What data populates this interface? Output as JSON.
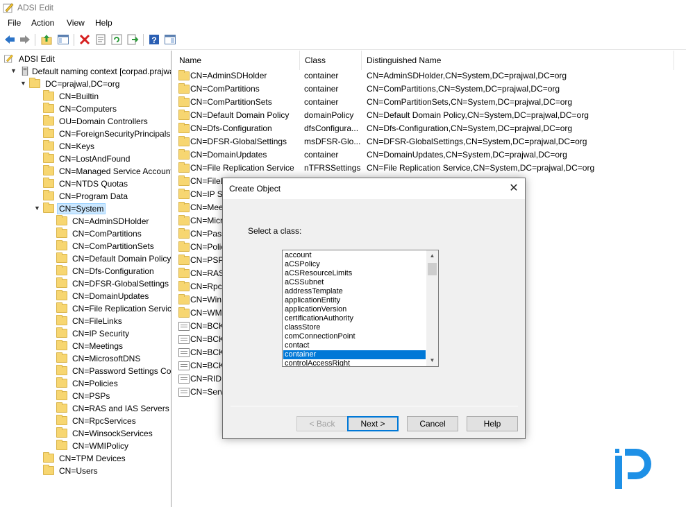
{
  "window": {
    "title": "ADSI Edit"
  },
  "menu": [
    "File",
    "Action",
    "View",
    "Help"
  ],
  "toolbar_icons": [
    "back-arrow-icon",
    "forward-arrow-icon",
    "up-folder-icon",
    "show-hide-tree-icon",
    "delete-icon",
    "properties-icon",
    "refresh-icon",
    "export-list-icon",
    "help-icon",
    "console-tree-icon"
  ],
  "tree": {
    "root": "ADSI Edit",
    "context": "Default naming context [corpad.prajwal.org]",
    "domain": "DC=prajwal,DC=org",
    "level1": [
      "CN=Builtin",
      "CN=Computers",
      "OU=Domain Controllers",
      "CN=ForeignSecurityPrincipals",
      "CN=Keys",
      "CN=LostAndFound",
      "CN=Managed Service Accounts",
      "CN=NTDS Quotas",
      "CN=Program Data",
      "CN=System"
    ],
    "system_children": [
      "CN=AdminSDHolder",
      "CN=ComPartitions",
      "CN=ComPartitionSets",
      "CN=Default Domain Policy",
      "CN=Dfs-Configuration",
      "CN=DFSR-GlobalSettings",
      "CN=DomainUpdates",
      "CN=File Replication Service",
      "CN=FileLinks",
      "CN=IP Security",
      "CN=Meetings",
      "CN=MicrosoftDNS",
      "CN=Password Settings Container",
      "CN=Policies",
      "CN=PSPs",
      "CN=RAS and IAS Servers Access Check",
      "CN=RpcServices",
      "CN=WinsockServices",
      "CN=WMIPolicy"
    ],
    "level1_after": [
      "CN=TPM Devices",
      "CN=Users"
    ]
  },
  "list": {
    "headers": [
      "Name",
      "Class",
      "Distinguished Name"
    ],
    "rows": [
      {
        "name": "CN=AdminSDHolder",
        "cls": "container",
        "dn": "CN=AdminSDHolder,CN=System,DC=prajwal,DC=org",
        "icon": "folder"
      },
      {
        "name": "CN=ComPartitions",
        "cls": "container",
        "dn": "CN=ComPartitions,CN=System,DC=prajwal,DC=org",
        "icon": "folder"
      },
      {
        "name": "CN=ComPartitionSets",
        "cls": "container",
        "dn": "CN=ComPartitionSets,CN=System,DC=prajwal,DC=org",
        "icon": "folder"
      },
      {
        "name": "CN=Default Domain Policy",
        "cls": "domainPolicy",
        "dn": "CN=Default Domain Policy,CN=System,DC=prajwal,DC=org",
        "icon": "folder"
      },
      {
        "name": "CN=Dfs-Configuration",
        "cls": "dfsConfigura...",
        "dn": "CN=Dfs-Configuration,CN=System,DC=prajwal,DC=org",
        "icon": "folder"
      },
      {
        "name": "CN=DFSR-GlobalSettings",
        "cls": "msDFSR-Glo...",
        "dn": "CN=DFSR-GlobalSettings,CN=System,DC=prajwal,DC=org",
        "icon": "folder"
      },
      {
        "name": "CN=DomainUpdates",
        "cls": "container",
        "dn": "CN=DomainUpdates,CN=System,DC=prajwal,DC=org",
        "icon": "folder"
      },
      {
        "name": "CN=File Replication Service",
        "cls": "nTFRSSettings",
        "dn": "CN=File Replication Service,CN=System,DC=prajwal,DC=org",
        "icon": "folder"
      },
      {
        "name": "CN=FileL",
        "cls": "",
        "dn": "org",
        "icon": "folder"
      },
      {
        "name": "CN=IP Se",
        "cls": "",
        "dn": "org",
        "icon": "folder"
      },
      {
        "name": "CN=Mee",
        "cls": "",
        "dn": "org",
        "icon": "folder"
      },
      {
        "name": "CN=Micr",
        "cls": "",
        "dn": "DC=org",
        "icon": "folder"
      },
      {
        "name": "CN=Pass",
        "cls": "",
        "dn": "em,DC=prajwal,DC=org",
        "icon": "folder"
      },
      {
        "name": "CN=Polic",
        "cls": "",
        "dn": "org",
        "icon": "folder"
      },
      {
        "name": "CN=PSPs",
        "cls": "",
        "dn": "",
        "icon": "folder"
      },
      {
        "name": "CN=RAS",
        "cls": "",
        "dn": "=System,DC=prajwal,DC=org",
        "icon": "folder"
      },
      {
        "name": "CN=Rpc",
        "cls": "",
        "dn": "C=org",
        "icon": "folder"
      },
      {
        "name": "CN=Win",
        "cls": "",
        "dn": "al,DC=org",
        "icon": "folder"
      },
      {
        "name": "CN=WM",
        "cls": "",
        "dn": "=org",
        "icon": "folder"
      },
      {
        "name": "CN=BCK",
        "cls": "",
        "dn": "1b76f21fa25d Secret,CN=System,DC=...",
        "icon": "secret"
      },
      {
        "name": "CN=BCK",
        "cls": "",
        "dn": "72da18c5234 Secret,CN=System,DC=...",
        "icon": "secret"
      },
      {
        "name": "CN=BCK",
        "cls": "",
        "dn": "al,DC=org",
        "icon": "secret"
      },
      {
        "name": "CN=BCK",
        "cls": "",
        "dn": "tem,DC=prajwal,DC=org",
        "icon": "secret"
      },
      {
        "name": "CN=RID",
        "cls": "",
        "dn": "DC=org",
        "icon": "secret"
      },
      {
        "name": "CN=Serv",
        "cls": "",
        "dn": "g",
        "icon": "secret"
      }
    ]
  },
  "dialog": {
    "title": "Create Object",
    "close": "✕",
    "label": "Select a class:",
    "classes": [
      "account",
      "aCSPolicy",
      "aCSResourceLimits",
      "aCSSubnet",
      "addressTemplate",
      "applicationEntity",
      "applicationVersion",
      "certificationAuthority",
      "classStore",
      "comConnectionPoint",
      "contact",
      "container",
      "controlAccessRight"
    ],
    "selected_class": "container",
    "buttons": {
      "back": "< Back",
      "next": "Next >",
      "cancel": "Cancel",
      "help": "Help"
    }
  },
  "colors": {
    "selection": "#0078d7",
    "tree_selection": "#cce8ff",
    "folder": "#f7d671",
    "logo": "#1e90e6"
  }
}
